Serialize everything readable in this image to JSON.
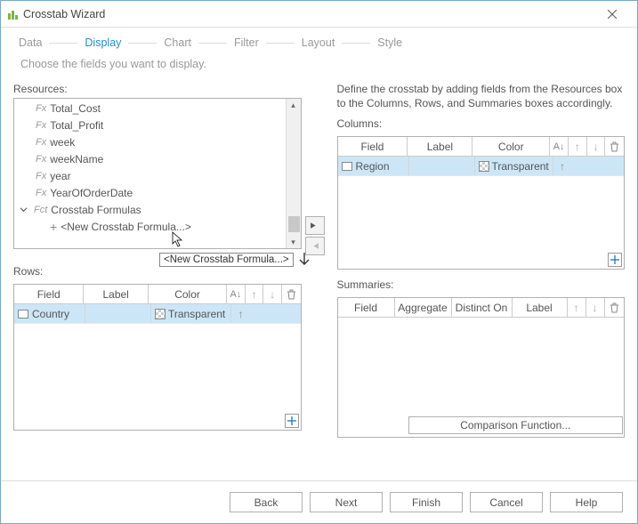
{
  "window": {
    "title": "Crosstab Wizard"
  },
  "steps": [
    "Data",
    "Display",
    "Chart",
    "Filter",
    "Layout",
    "Style"
  ],
  "active_step": 1,
  "instruction": "Choose the fields you want to display.",
  "resources": {
    "label": "Resources:",
    "items": [
      {
        "kind": "fx",
        "label": "Total_Cost"
      },
      {
        "kind": "fx",
        "label": "Total_Profit"
      },
      {
        "kind": "fx",
        "label": "week"
      },
      {
        "kind": "fx",
        "label": "weekName"
      },
      {
        "kind": "fx",
        "label": "year"
      },
      {
        "kind": "fx",
        "label": "YearOfOrderDate"
      }
    ],
    "group_label": "Crosstab Formulas",
    "new_item": "<New Crosstab Formula...>"
  },
  "drag_tooltip": "<New Crosstab Formula...>",
  "rows": {
    "label": "Rows:",
    "headers": {
      "field": "Field",
      "label": "Label",
      "color": "Color"
    },
    "data": [
      {
        "field": "Country",
        "label_val": "",
        "color": "Transparent",
        "sort": "asc"
      }
    ]
  },
  "define_text": "Define the crosstab by adding fields from the Resources box to the Columns, Rows, and Summaries boxes accordingly.",
  "columns": {
    "label": "Columns:",
    "headers": {
      "field": "Field",
      "label": "Label",
      "color": "Color"
    },
    "data": [
      {
        "field": "Region",
        "label_val": "",
        "color": "Transparent",
        "sort": "asc"
      }
    ]
  },
  "summaries": {
    "label": "Summaries:",
    "headers": {
      "field": "Field",
      "aggregate": "Aggregate",
      "distinct": "Distinct On",
      "label": "Label"
    }
  },
  "comp_fn": "Comparison Function...",
  "buttons": {
    "back": "Back",
    "next": "Next",
    "finish": "Finish",
    "cancel": "Cancel",
    "help": "Help"
  }
}
